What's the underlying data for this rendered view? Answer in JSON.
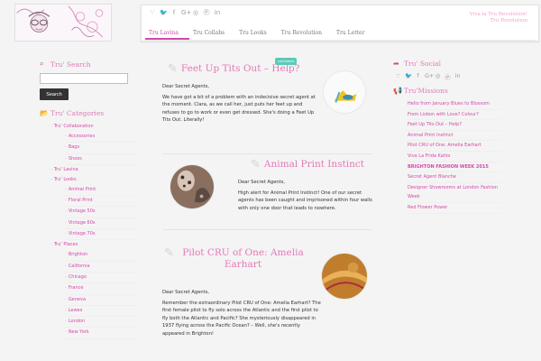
{
  "header": {
    "motto_line1": "Viva la Tru Revolution!",
    "motto_line2": "Tru Revolution",
    "social_icons": [
      "rss-icon",
      "twitter-icon",
      "facebook-icon",
      "google-plus-icon",
      "instagram-icon",
      "pinterest-icon",
      "linkedin-icon"
    ],
    "social_glyphs": [
      ")",
      "t",
      "f",
      "G+",
      "◎",
      "P",
      "in"
    ],
    "nav": [
      "Tru Lavina",
      "Tru Collabs",
      "Tru Looks",
      "Tru Revolution",
      "Tru Letter"
    ]
  },
  "search": {
    "title": "Tru' Search",
    "button": "Search",
    "placeholder": ""
  },
  "categories": {
    "title": "Tru' Categories",
    "collaboration": "Tru' Collaboration",
    "collab_items": [
      "Accessories",
      "Bags",
      "Shoes"
    ],
    "lavina": "Tru' Lavina",
    "looks": "Tru' Looks",
    "looks_items": [
      "Animal Print",
      "Floral Print",
      "Vintage 50s",
      "Vintage 60s",
      "Vintage 70s"
    ],
    "places": "Tru' Places",
    "places_items": [
      "Brighton",
      "California",
      "Chicago",
      "France",
      "Geneva",
      "Lewes",
      "London",
      "New York"
    ]
  },
  "social": {
    "title": "Tru' Social",
    "icons": [
      "rss-icon",
      "twitter-icon",
      "facebook-icon",
      "google-plus-icon",
      "instagram-icon",
      "pinterest-icon",
      "linkedin-icon"
    ]
  },
  "missions": {
    "title": "Tru'Missions",
    "items": [
      "Hello from January Blues to Blossom",
      "From Lisbon with Love? Colour?",
      "Feet Up Tits Out – Help?",
      "Animal Print Instinct",
      "Pilot CRU of One: Amelia Earhart",
      "Viva La Frida Kahlo",
      "BRIGHTON FASHION WEEK 2015",
      "Secret Agent Blanche",
      "Designer Showrooms at London Fashion Week",
      "Red Flower Power"
    ]
  },
  "posts": [
    {
      "title": "Feet Up Tits Out – Help?",
      "badge": "comments",
      "greeting": "Dear Secret Agents,",
      "body": "We have got a bit of a problem with an indecisive secret agent at the moment. Clara, as we call her, just puts her feet up and refuses to go to work or even get dressed. She's doing a Feet Up Tits Out. Literally!"
    },
    {
      "title": "Animal Print Instinct",
      "greeting": "Dear Secret Agents,",
      "body": "High alert for Animal Print Instinct! One of our secret agents has been caught and imprisoned within four walls with only one door that leads to nowhere."
    },
    {
      "title": "Pilot CRU of One: Amelia Earhart",
      "greeting": "Dear Secret Agents,",
      "body": "Remember the extraordinary Pilot CRU of One: Amelia Earhart? The first female pilot to fly solo across the Atlantic and the first pilot to fly both the Atlantic and Pacific? She mysteriously disappeared in 1937 flying across the Pacific Ocean? – Well, she's recently appeared in Brighton!"
    }
  ],
  "colors": {
    "accent": "#d24aa8",
    "heading": "#e179b8",
    "motto": "#f2a3cc",
    "badge": "#5ccab8"
  }
}
